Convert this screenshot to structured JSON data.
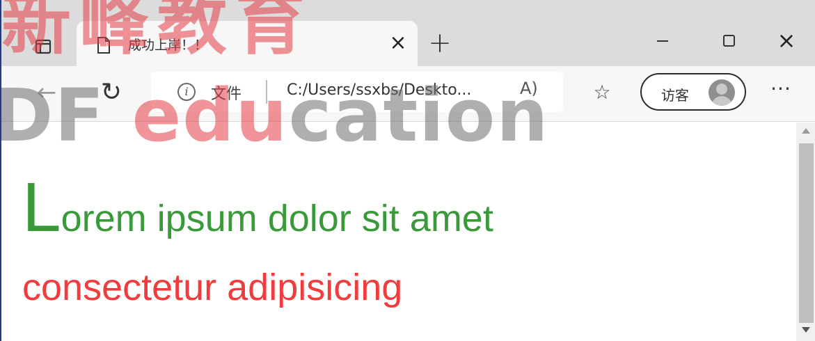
{
  "tab": {
    "title": "成功上岸！！",
    "close_glyph": "×"
  },
  "new_tab_glyph": "+",
  "window_controls": {
    "close_glyph": "×"
  },
  "toolbar": {
    "back_glyph": "←",
    "refresh_glyph": "↻",
    "info_glyph": "i",
    "file_label": "文件",
    "url": "C:/Users/ssxbs/Deskto...",
    "read_aloud": "A)",
    "favorite_glyph": "☆",
    "guest_label": "访客",
    "more_glyph": "···"
  },
  "content": {
    "line1_first_letter": "L",
    "line1_rest": "orem ipsum dolor sit amet",
    "line2": "consectetur adipisicing"
  },
  "watermark": {
    "top_text": "新峰教育",
    "main_gray": "DF ",
    "main_red": "edu",
    "main_gray_end": "cation"
  },
  "colors": {
    "green_text": "#3a9a3a",
    "red_text": "#f03c3c",
    "watermark_red": "#e43c46",
    "watermark_gray": "#6e6e6e"
  }
}
